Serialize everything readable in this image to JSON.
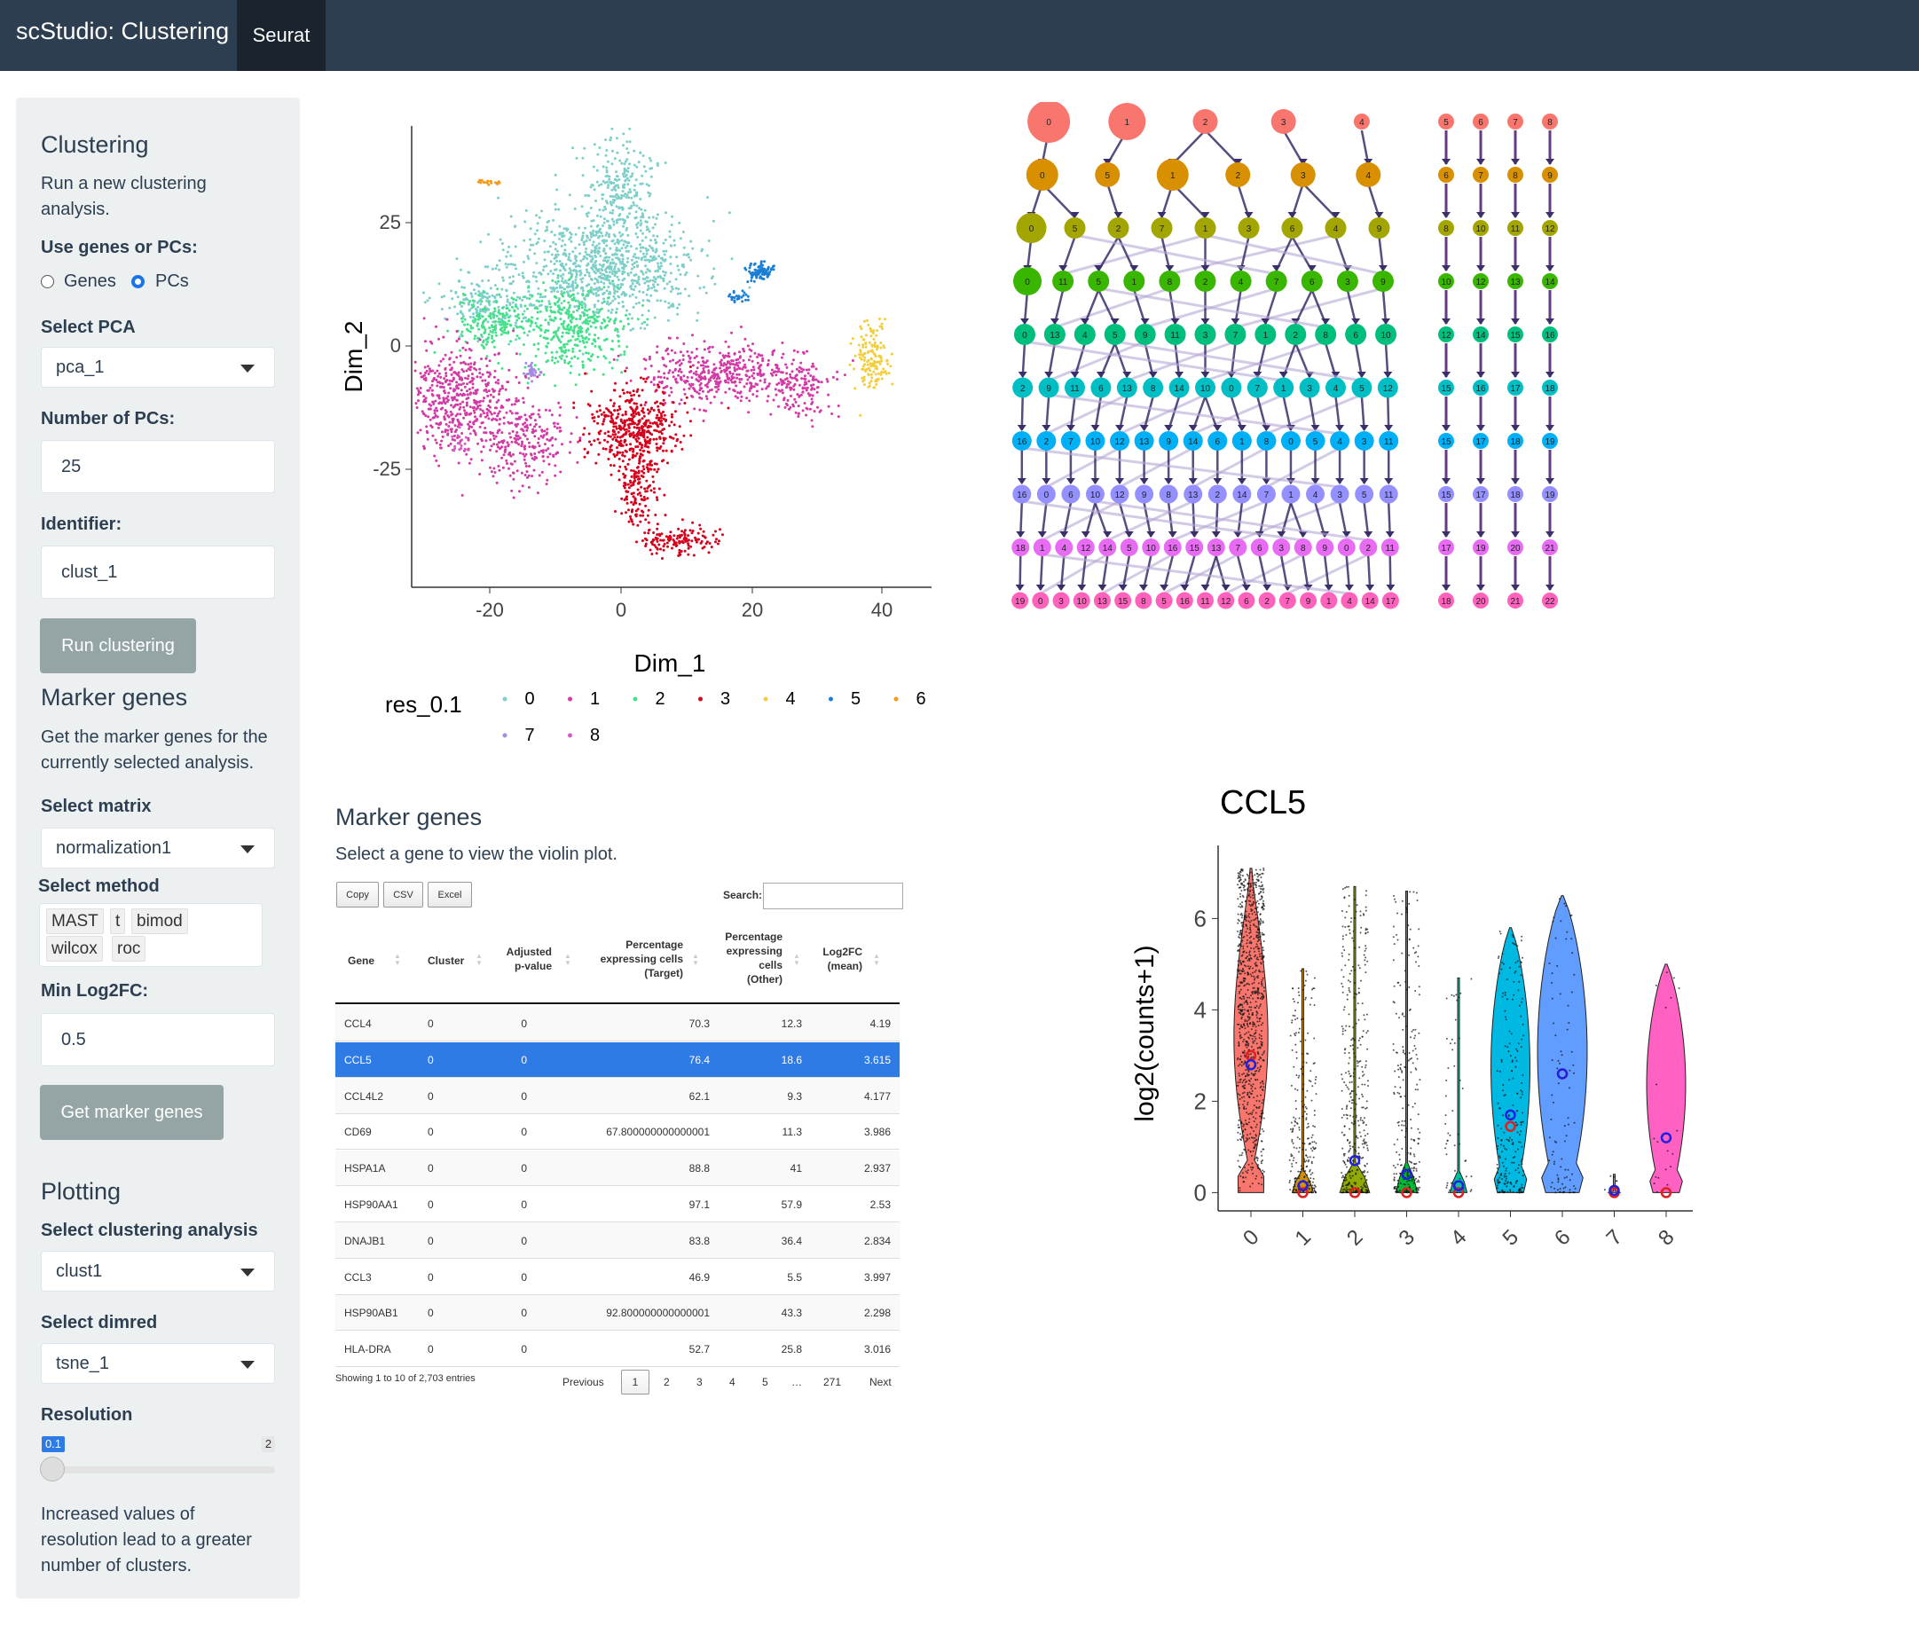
{
  "app": {
    "title": "scStudio: Clustering",
    "tab": "Seurat"
  },
  "sidebar": {
    "clustering": {
      "heading": "Clustering",
      "desc_line1": "Run a new clustering",
      "desc_line2": "analysis.",
      "use_label": "Use genes or PCs:",
      "opt_genes": "Genes",
      "opt_pcs": "PCs",
      "selected_option": "PCs",
      "pca_label": "Select PCA",
      "pca_value": "pca_1",
      "npcs_label": "Number of PCs:",
      "npcs_value": "25",
      "ident_label": "Identifier:",
      "ident_value": "clust_1",
      "run_button": "Run clustering"
    },
    "markers": {
      "heading": "Marker genes",
      "desc_line1": "Get the marker genes for the",
      "desc_line2": "currently selected analysis.",
      "matrix_label": "Select matrix",
      "matrix_value": "normalization1",
      "method_label": "Select method",
      "methods": [
        "MAST",
        "t",
        "bimod",
        "wilcox",
        "roc"
      ],
      "minlfc_label": "Min Log2FC:",
      "minlfc_value": "0.5",
      "get_button": "Get marker genes"
    },
    "plotting": {
      "heading": "Plotting",
      "analysis_label": "Select clustering analysis",
      "analysis_value": "clust1",
      "dimred_label": "Select dimred",
      "dimred_value": "tsne_1",
      "res_label": "Resolution",
      "res_value": 0.1,
      "res_value_text": "0.1",
      "res_max": "2",
      "note_line1": "Increased values of",
      "note_line2": "resolution lead to a greater",
      "note_line3": "number of clusters."
    }
  },
  "tsne": {
    "xlabel": "Dim_1",
    "ylabel": "Dim_2",
    "xticks": [
      "-20",
      "0",
      "20",
      "40"
    ],
    "yticks": [
      "25",
      "0",
      "-25"
    ],
    "legend_title": "res_0.1",
    "legend": [
      {
        "label": "0",
        "color": "#7ecfc8"
      },
      {
        "label": "1",
        "color": "#d33aa5"
      },
      {
        "label": "2",
        "color": "#45e08a"
      },
      {
        "label": "3",
        "color": "#d6001c"
      },
      {
        "label": "4",
        "color": "#f3ce3c"
      },
      {
        "label": "5",
        "color": "#1a7fd4"
      },
      {
        "label": "6",
        "color": "#f59a1a"
      },
      {
        "label": "7",
        "color": "#a58be0"
      },
      {
        "label": "8",
        "color": "#d35cc0"
      }
    ]
  },
  "clustree": {
    "colors": [
      "#f8766d",
      "#d89000",
      "#a3a500",
      "#39b600",
      "#00bf7d",
      "#00bfc4",
      "#00b0f6",
      "#9590ff",
      "#e76bf3",
      "#ff62bc"
    ],
    "rows": [
      [
        "0",
        "1",
        "2",
        "3",
        "4",
        "",
        "5",
        "6",
        "7",
        "8"
      ],
      [
        "0",
        "5",
        "1",
        "2",
        "3",
        "4",
        "",
        "6",
        "7",
        "8",
        "9"
      ],
      [
        "0",
        "5",
        "2",
        "7",
        "1",
        "3",
        "6",
        "4",
        "9",
        "",
        "8",
        "10",
        "11",
        "12"
      ],
      [
        "0",
        "11",
        "5",
        "1",
        "8",
        "2",
        "4",
        "7",
        "6",
        "3",
        "9",
        "",
        "10",
        "12",
        "13",
        "14"
      ],
      [
        "0",
        "13",
        "4",
        "5",
        "9",
        "11",
        "3",
        "7",
        "1",
        "2",
        "8",
        "6",
        "10",
        "",
        "12",
        "14",
        "15",
        "16"
      ],
      [
        "2",
        "9",
        "11",
        "6",
        "13",
        "8",
        "14",
        "10",
        "0",
        "7",
        "1",
        "3",
        "4",
        "5",
        "12",
        "",
        "15",
        "16",
        "17",
        "18"
      ],
      [
        "16",
        "2",
        "7",
        "10",
        "12",
        "13",
        "9",
        "14",
        "6",
        "1",
        "8",
        "0",
        "5",
        "4",
        "3",
        "11",
        "",
        "15",
        "17",
        "18",
        "19"
      ],
      [
        "16",
        "0",
        "6",
        "10",
        "12",
        "9",
        "8",
        "13",
        "2",
        "14",
        "7",
        "1",
        "4",
        "3",
        "5",
        "11",
        "",
        "15",
        "17",
        "18",
        "19"
      ],
      [
        "18",
        "1",
        "4",
        "12",
        "14",
        "5",
        "10",
        "16",
        "15",
        "13",
        "7",
        "6",
        "3",
        "8",
        "9",
        "0",
        "2",
        "11",
        "",
        "17",
        "19",
        "20",
        "21"
      ],
      [
        "19",
        "0",
        "3",
        "10",
        "13",
        "15",
        "8",
        "5",
        "16",
        "11",
        "12",
        "6",
        "2",
        "7",
        "9",
        "1",
        "4",
        "14",
        "17",
        "",
        "18",
        "20",
        "21",
        "22"
      ]
    ]
  },
  "marker_table": {
    "title": "Marker genes",
    "subtitle": "Select a gene to view the violin plot.",
    "buttons": [
      "Copy",
      "CSV",
      "Excel"
    ],
    "search_label": "Search:",
    "columns": {
      "gene": "Gene",
      "cluster": "Cluster",
      "padj_1": "Adjusted",
      "padj_2": "p-value",
      "pt_1": "Percentage",
      "pt_2": "expressing cells",
      "pt_3": "(Target)",
      "po_1": "Percentage",
      "po_2": "expressing",
      "po_3": "cells",
      "po_4": "(Other)",
      "lfc_1": "Log2FC",
      "lfc_2": "(mean)"
    },
    "rows": [
      {
        "gene": "CCL4",
        "cluster": "0",
        "padj": "0",
        "pt": "70.3",
        "po": "12.3",
        "lfc": "4.19"
      },
      {
        "gene": "CCL5",
        "cluster": "0",
        "padj": "0",
        "pt": "76.4",
        "po": "18.6",
        "lfc": "3.615"
      },
      {
        "gene": "CCL4L2",
        "cluster": "0",
        "padj": "0",
        "pt": "62.1",
        "po": "9.3",
        "lfc": "4.177"
      },
      {
        "gene": "CD69",
        "cluster": "0",
        "padj": "0",
        "pt": "67.800000000000001",
        "po": "11.3",
        "lfc": "3.986"
      },
      {
        "gene": "HSPA1A",
        "cluster": "0",
        "padj": "0",
        "pt": "88.8",
        "po": "41",
        "lfc": "2.937"
      },
      {
        "gene": "HSP90AA1",
        "cluster": "0",
        "padj": "0",
        "pt": "97.1",
        "po": "57.9",
        "lfc": "2.53"
      },
      {
        "gene": "DNAJB1",
        "cluster": "0",
        "padj": "0",
        "pt": "83.8",
        "po": "36.4",
        "lfc": "2.834"
      },
      {
        "gene": "CCL3",
        "cluster": "0",
        "padj": "0",
        "pt": "46.9",
        "po": "5.5",
        "lfc": "3.997"
      },
      {
        "gene": "HSP90AB1",
        "cluster": "0",
        "padj": "0",
        "pt": "92.800000000000001",
        "po": "43.3",
        "lfc": "2.298"
      },
      {
        "gene": "HLA-DRA",
        "cluster": "0",
        "padj": "0",
        "pt": "52.7",
        "po": "25.8",
        "lfc": "3.016"
      }
    ],
    "info": "Showing 1 to 10 of 2,703 entries",
    "pagination": {
      "previous": "Previous",
      "pages": [
        "1",
        "2",
        "3",
        "4",
        "5",
        "…",
        "271"
      ],
      "next": "Next",
      "current": "1"
    }
  },
  "chart_data": {
    "type": "violin",
    "title": "CCL5",
    "ylabel": "log2(counts+1)",
    "categories": [
      "0",
      "1",
      "2",
      "3",
      "4",
      "5",
      "6",
      "7",
      "8"
    ],
    "yticks": [
      "0",
      "2",
      "4",
      "6"
    ],
    "ylim": [
      -0.4,
      7.6
    ],
    "colors": [
      "#f8766d",
      "#d39200",
      "#93aa00",
      "#00ba38",
      "#00c19f",
      "#00b9e3",
      "#619cff",
      "#db72fb",
      "#ff61c3"
    ],
    "max": [
      7.1,
      4.9,
      6.7,
      6.6,
      4.7,
      5.8,
      6.5,
      0.4,
      5.0
    ],
    "mean": [
      2.8,
      0.15,
      0.7,
      0.4,
      0.15,
      1.7,
      2.6,
      0.05,
      1.2
    ],
    "median": [
      3.0,
      0.0,
      0.0,
      0.0,
      0.0,
      1.45,
      2.6,
      0.0,
      0.0
    ]
  }
}
